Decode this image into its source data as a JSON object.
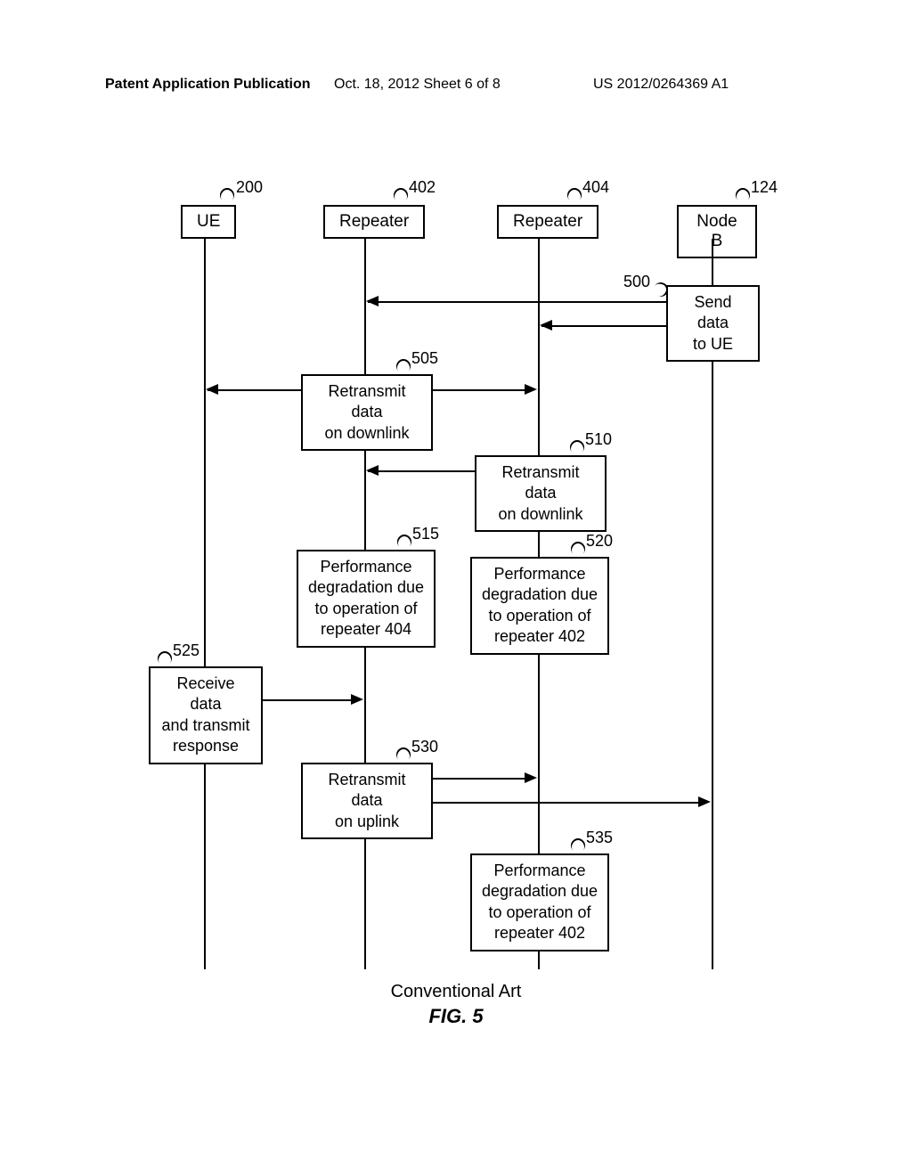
{
  "header": {
    "left": "Patent Application Publication",
    "center": "Oct. 18, 2012  Sheet 6 of 8",
    "right": "US 2012/0264369 A1"
  },
  "entities": {
    "ue": {
      "label": "UE",
      "ref": "200"
    },
    "repeater1": {
      "label": "Repeater",
      "ref": "402"
    },
    "repeater2": {
      "label": "Repeater",
      "ref": "404"
    },
    "nodeb": {
      "label": "Node B",
      "ref": "124"
    }
  },
  "boxes": {
    "b500": {
      "ref": "500",
      "text": "Send data\nto UE"
    },
    "b505": {
      "ref": "505",
      "text": "Retransmit data\non downlink"
    },
    "b510": {
      "ref": "510",
      "text": "Retransmit data\non downlink"
    },
    "b515": {
      "ref": "515",
      "text": "Performance\ndegradation due\nto operation of\nrepeater 404"
    },
    "b520": {
      "ref": "520",
      "text": "Performance\ndegradation due\nto operation of\nrepeater 402"
    },
    "b525": {
      "ref": "525",
      "text": "Receive data\nand transmit\nresponse"
    },
    "b530": {
      "ref": "530",
      "text": "Retransmit data\non uplink"
    },
    "b535": {
      "ref": "535",
      "text": "Performance\ndegradation due\nto operation of\nrepeater 402"
    }
  },
  "footer": {
    "caption": "Conventional Art",
    "fig": "FIG. 5"
  }
}
